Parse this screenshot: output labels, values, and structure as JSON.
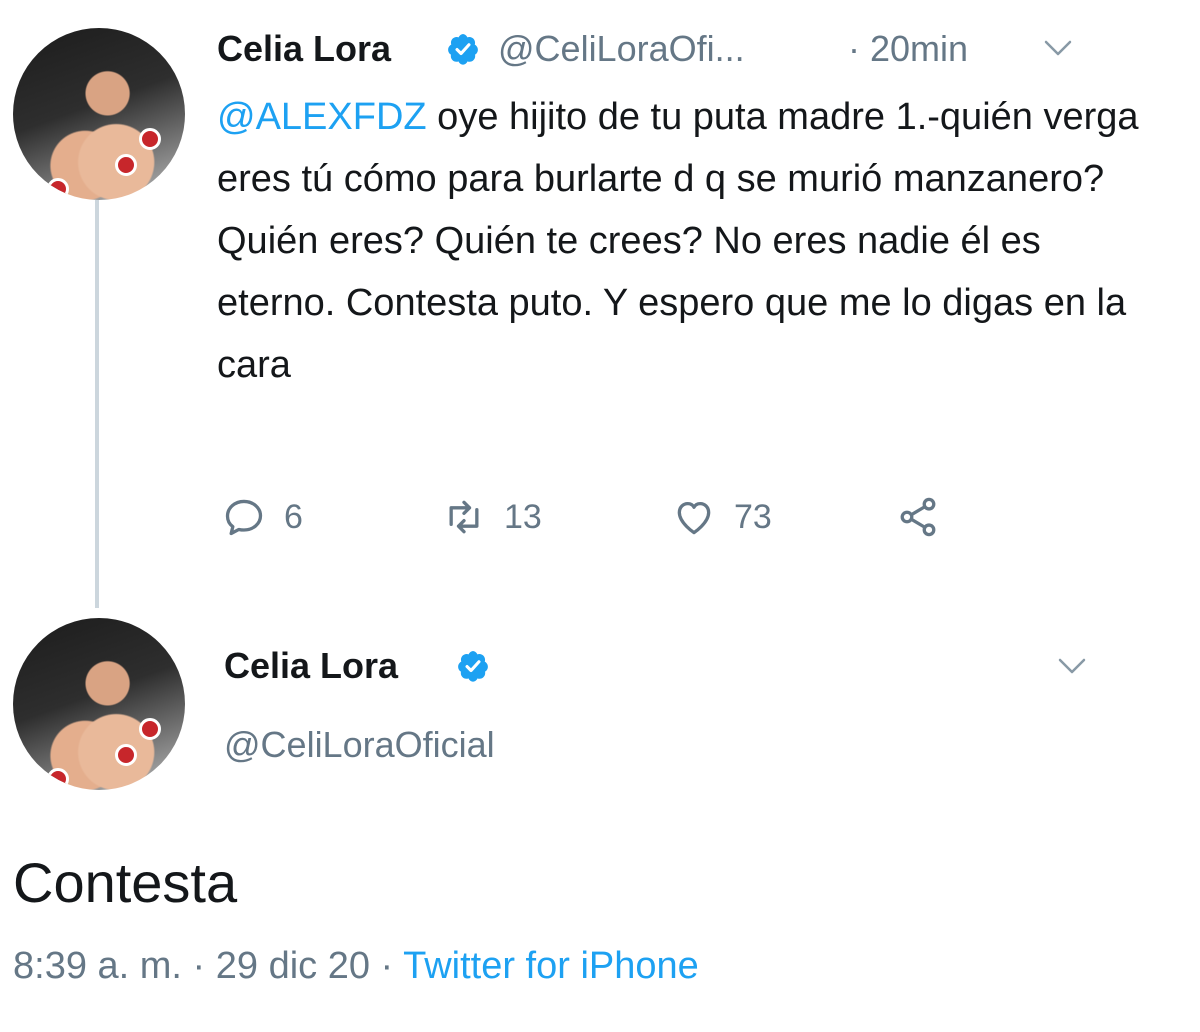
{
  "first_tweet": {
    "name": "Celia Lora",
    "handle": "@CeliLoraOfi...",
    "time": "· 20min",
    "mention": "@ALEXFDZ",
    "text": " oye hijito de tu puta madre 1.-quién verga eres tú cómo para burlarte d q se murió manzanero? Quién eres? Quién te crees? No eres nadie él es eterno. Contesta puto. Y espero que me lo digas en la cara",
    "replies": "6",
    "retweets": "13",
    "likes": "73"
  },
  "second_tweet": {
    "name": "Celia Lora",
    "handle": "@CeliLoraOficial",
    "text": "Contesta",
    "timestamp": "8:39 a. m.",
    "date": "29 dic 20",
    "source": "Twitter for iPhone"
  },
  "colors": {
    "accent": "#1da1f2",
    "secondary_text": "#657786",
    "primary_text": "#14171a"
  },
  "icons": [
    "verified-badge-icon",
    "chevron-down-icon",
    "reply-icon",
    "retweet-icon",
    "like-icon",
    "share-icon"
  ]
}
